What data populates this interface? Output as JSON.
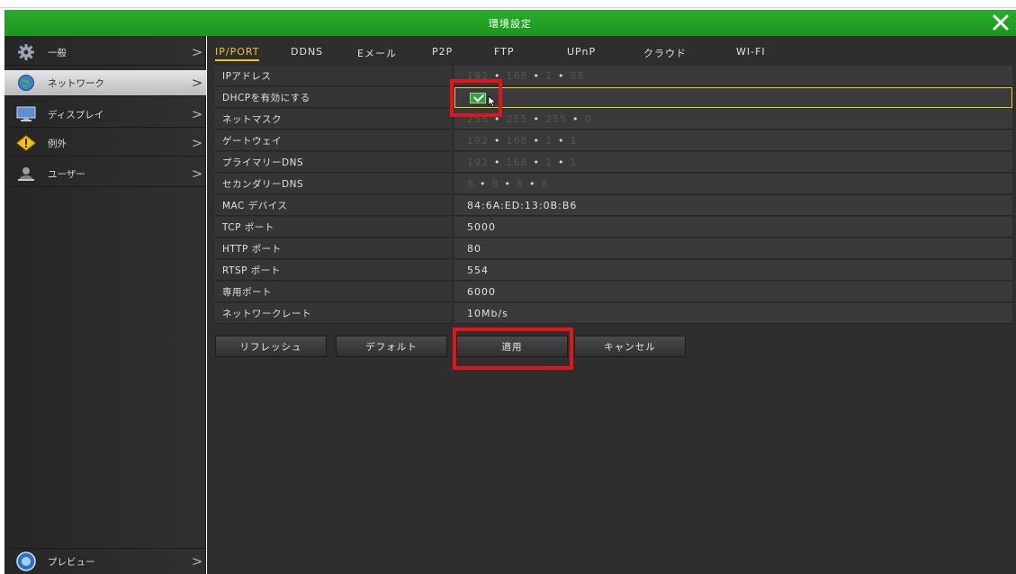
{
  "window": {
    "title": "環境設定"
  },
  "sidebar": {
    "items": [
      {
        "label": "一般",
        "icon": "gear-icon"
      },
      {
        "label": "ネットワーク",
        "icon": "globe-icon"
      },
      {
        "label": "ディスプレイ",
        "icon": "monitor-icon"
      },
      {
        "label": "例外",
        "icon": "warning-icon"
      },
      {
        "label": "ユーザー",
        "icon": "user-icon"
      }
    ],
    "preview": {
      "label": "プレビュー",
      "icon": "preview-icon"
    },
    "active_index": 1
  },
  "tabs": [
    {
      "label": "IP/PORT"
    },
    {
      "label": "DDNS"
    },
    {
      "label": "Eメール"
    },
    {
      "label": "P2P"
    },
    {
      "label": "FTP"
    },
    {
      "label": "UPnP"
    },
    {
      "label": "クラウド"
    },
    {
      "label": "WI-FI"
    }
  ],
  "network": {
    "ip": {
      "label": "IPアドレス",
      "o1": "192",
      "o2": "168",
      "o3": "1",
      "o4": "88"
    },
    "dhcp": {
      "label": "DHCPを有効にする",
      "checked": true
    },
    "netmask": {
      "label": "ネットマスク",
      "o1": "255",
      "o2": "255",
      "o3": "255",
      "o4": "0"
    },
    "gateway": {
      "label": "ゲートウェイ",
      "o1": "192",
      "o2": "168",
      "o3": "1",
      "o4": "1"
    },
    "dns1": {
      "label": "プライマリーDNS",
      "o1": "192",
      "o2": "168",
      "o3": "1",
      "o4": "1"
    },
    "dns2": {
      "label": "セカンダリーDNS",
      "o1": "8",
      "o2": "8",
      "o3": "8",
      "o4": "8"
    },
    "mac": {
      "label": "MAC デバイス",
      "value": "84:6A:ED:13:0B:B6"
    },
    "tcp": {
      "label": "TCP ポート",
      "value": "5000"
    },
    "http": {
      "label": "HTTP ポート",
      "value": "80"
    },
    "rtsp": {
      "label": "RTSP ポート",
      "value": "554"
    },
    "private": {
      "label": "専用ポート",
      "value": "6000"
    },
    "rate": {
      "label": "ネットワークレート",
      "value": "10Mb/s"
    }
  },
  "buttons": {
    "refresh": "リフレッシュ",
    "default": "デフォルト",
    "apply": "適用",
    "cancel": "キャンセル"
  },
  "colors": {
    "titlebar": "#1f9a21",
    "active_tab": "#f2c230",
    "highlight_box": "#e2141c",
    "focus_border": "#e5d21c"
  }
}
